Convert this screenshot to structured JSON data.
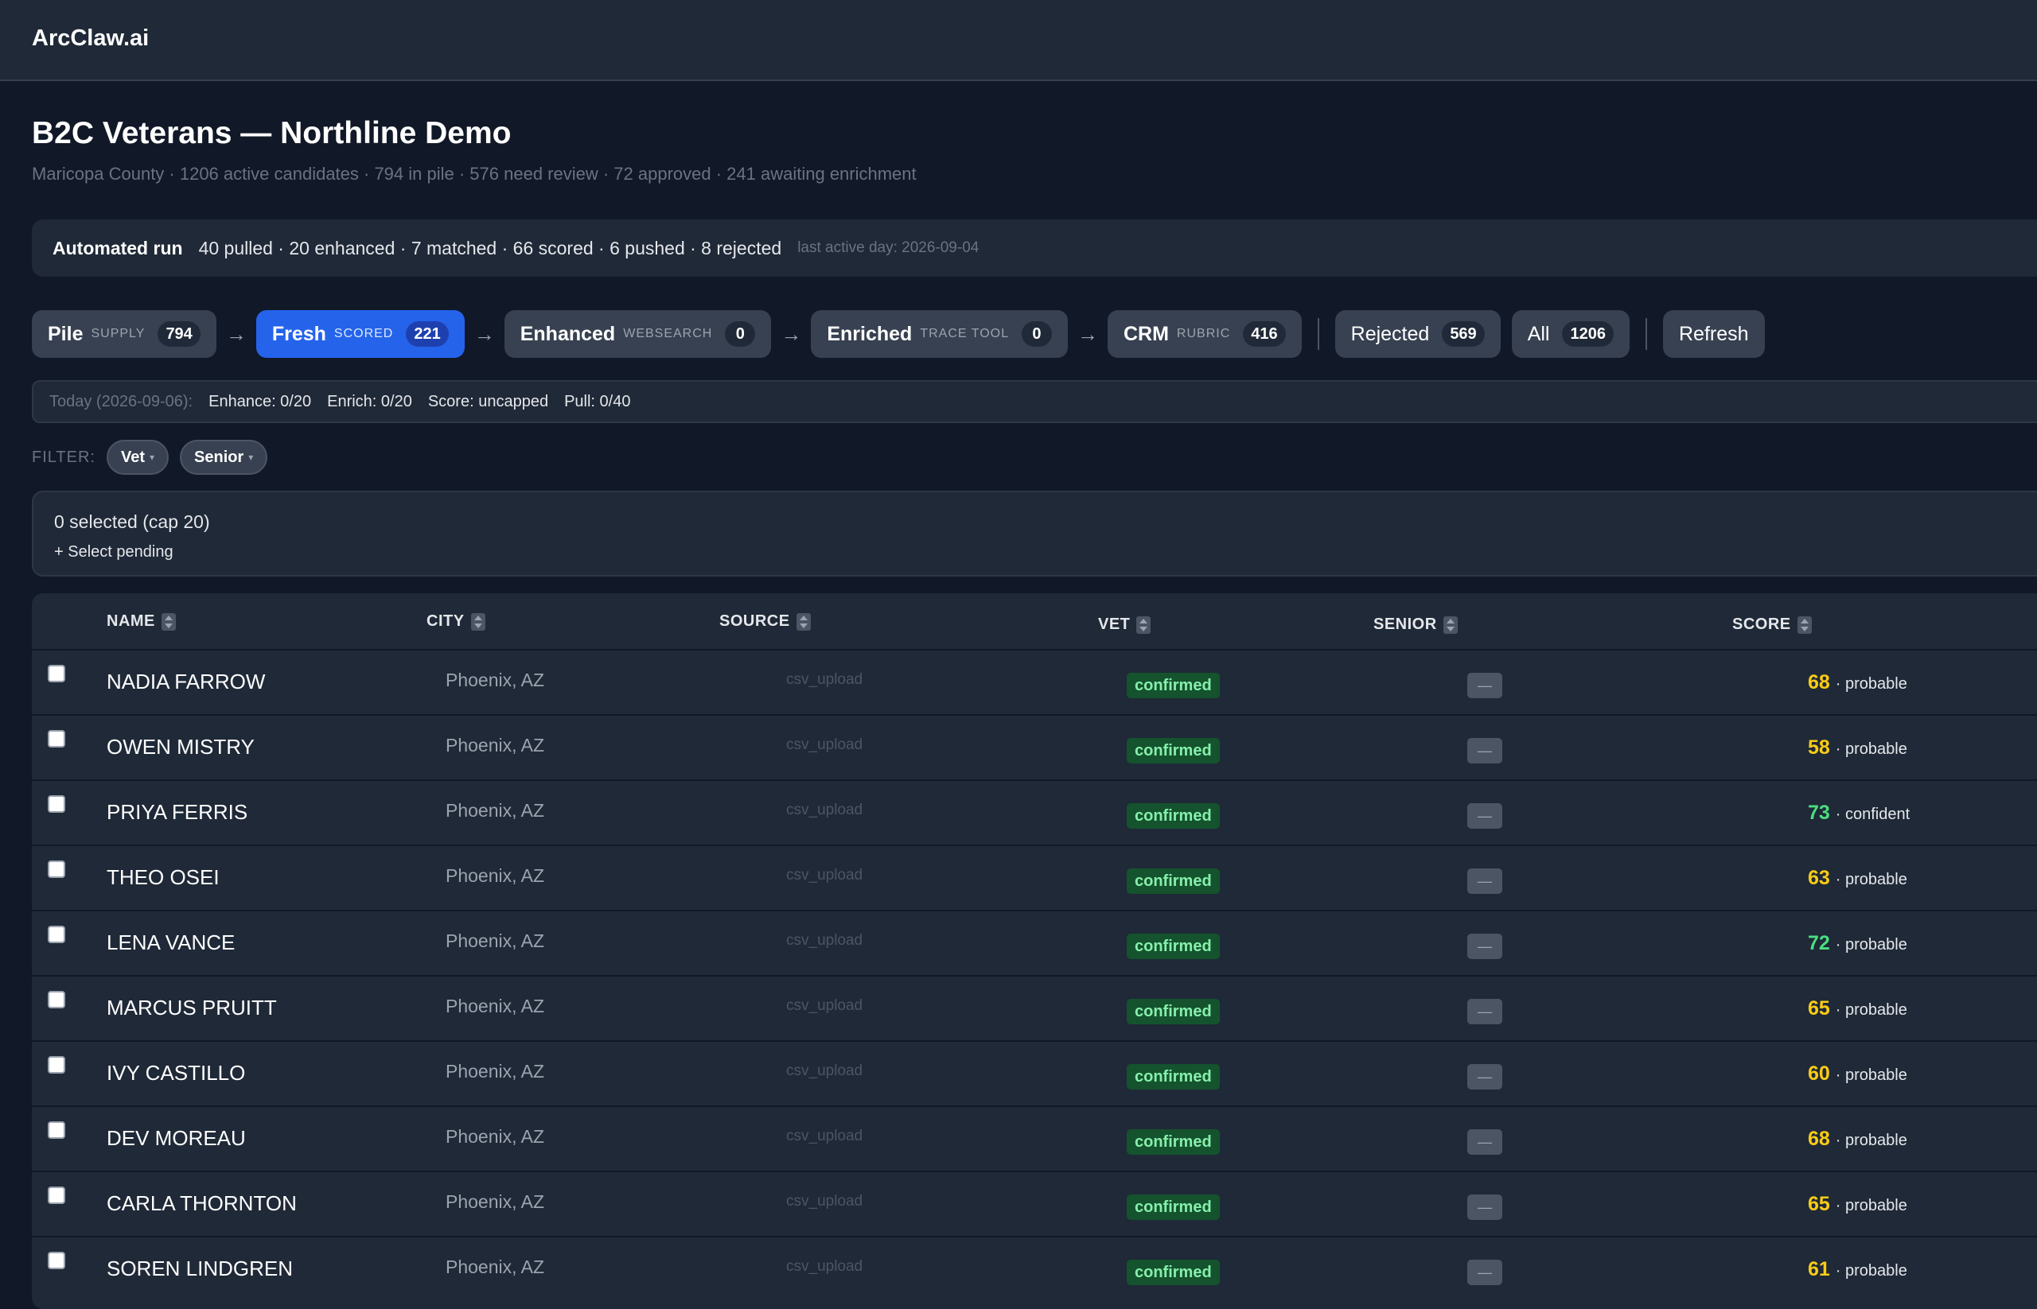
{
  "app": {
    "brand": "ArcClaw.ai"
  },
  "page": {
    "title": "B2C Veterans — Northline Demo",
    "subtitle": "Maricopa County · 1206 active candidates · 794 in pile · 576 need review · 72 approved · 241 awaiting enrichment"
  },
  "run": {
    "label": "Automated run",
    "stats": "40 pulled · 20 enhanced · 7 matched · 66 scored · 6 pushed · 8 rejected",
    "last_active": "last active day: 2026-09-04"
  },
  "stages": [
    {
      "label": "Pile",
      "sub": "SUPPLY",
      "count": "794"
    },
    {
      "label": "Fresh",
      "sub": "SCORED",
      "count": "221",
      "active": true
    },
    {
      "label": "Enhanced",
      "sub": "WEBSEARCH",
      "count": "0"
    },
    {
      "label": "Enriched",
      "sub": "TRACE TOOL",
      "count": "0"
    },
    {
      "label": "CRM",
      "sub": "RUBRIC",
      "count": "416"
    }
  ],
  "extra_chips": [
    {
      "label": "Rejected",
      "count": "569"
    },
    {
      "label": "All",
      "count": "1206"
    }
  ],
  "refresh_label": "Refresh",
  "today": {
    "label": "Today (2026-09-06):",
    "enhance": "Enhance: 0/20",
    "enrich": "Enrich: 0/20",
    "score": "Score: uncapped",
    "pull": "Pull: 0/40"
  },
  "filter": {
    "label": "FILTER:",
    "chips": [
      "Vet",
      "Senior"
    ],
    "caret": "▾"
  },
  "selection": {
    "count": "0 selected (cap 20)",
    "pending": "+ Select pending"
  },
  "table": {
    "headers": [
      "NAME",
      "CITY",
      "SOURCE",
      "VET",
      "SENIOR",
      "SCORE"
    ],
    "rows": [
      {
        "name": "NADIA FARROW",
        "city": "Phoenix, AZ",
        "source": "csv_upload",
        "vet": "confirmed",
        "senior": "—",
        "score": "68",
        "confidence": "· probable",
        "color": "#facc15"
      },
      {
        "name": "OWEN MISTRY",
        "city": "Phoenix, AZ",
        "source": "csv_upload",
        "vet": "confirmed",
        "senior": "—",
        "score": "58",
        "confidence": "· probable",
        "color": "#facc15"
      },
      {
        "name": "PRIYA FERRIS",
        "city": "Phoenix, AZ",
        "source": "csv_upload",
        "vet": "confirmed",
        "senior": "—",
        "score": "73",
        "confidence": "· confident",
        "color": "#4ade80"
      },
      {
        "name": "THEO OSEI",
        "city": "Phoenix, AZ",
        "source": "csv_upload",
        "vet": "confirmed",
        "senior": "—",
        "score": "63",
        "confidence": "· probable",
        "color": "#facc15"
      },
      {
        "name": "LENA VANCE",
        "city": "Phoenix, AZ",
        "source": "csv_upload",
        "vet": "confirmed",
        "senior": "—",
        "score": "72",
        "confidence": "· probable",
        "color": "#4ade80"
      },
      {
        "name": "MARCUS PRUITT",
        "city": "Phoenix, AZ",
        "source": "csv_upload",
        "vet": "confirmed",
        "senior": "—",
        "score": "65",
        "confidence": "· probable",
        "color": "#facc15"
      },
      {
        "name": "IVY CASTILLO",
        "city": "Phoenix, AZ",
        "source": "csv_upload",
        "vet": "confirmed",
        "senior": "—",
        "score": "60",
        "confidence": "· probable",
        "color": "#facc15"
      },
      {
        "name": "DEV MOREAU",
        "city": "Phoenix, AZ",
        "source": "csv_upload",
        "vet": "confirmed",
        "senior": "—",
        "score": "68",
        "confidence": "· probable",
        "color": "#facc15"
      },
      {
        "name": "CARLA THORNTON",
        "city": "Phoenix, AZ",
        "source": "csv_upload",
        "vet": "confirmed",
        "senior": "—",
        "score": "65",
        "confidence": "· probable",
        "color": "#facc15"
      },
      {
        "name": "SOREN LINDGREN",
        "city": "Phoenix, AZ",
        "source": "csv_upload",
        "vet": "confirmed",
        "senior": "—",
        "score": "61",
        "confidence": "· probable",
        "color": "#facc15"
      }
    ]
  }
}
